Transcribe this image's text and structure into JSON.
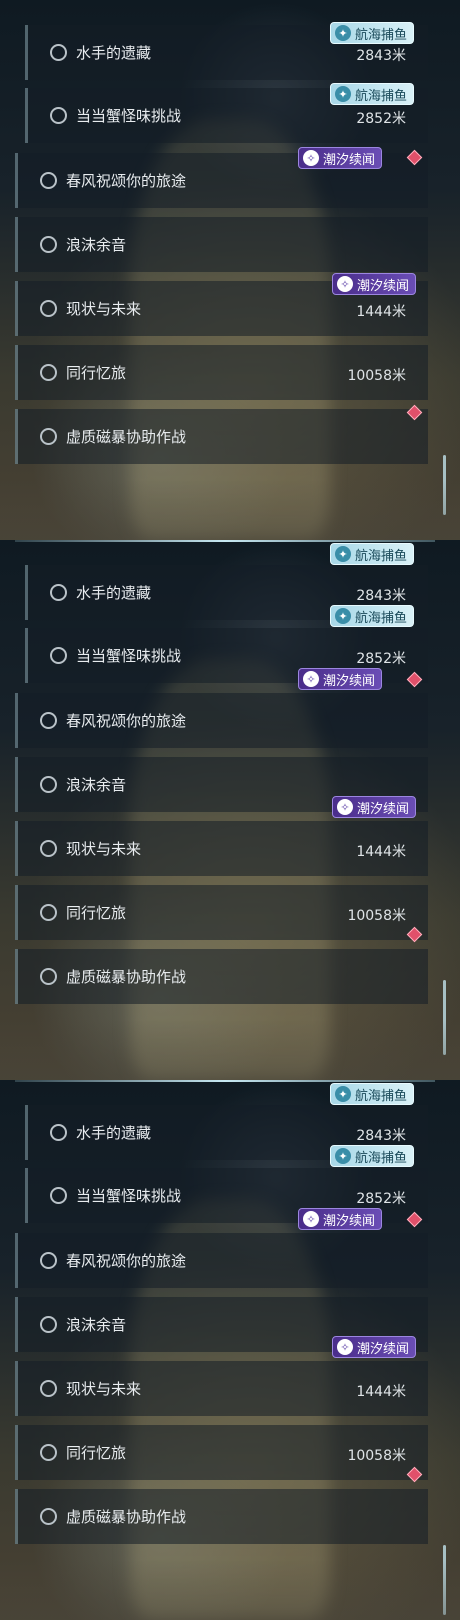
{
  "panels": [
    {
      "items": [
        {
          "label": "水手的遗藏",
          "distance": "2843米",
          "tag": "航海捕鱼"
        },
        {
          "label": "当当蟹怪味挑战",
          "distance": "2852米",
          "tag": "航海捕鱼"
        },
        {
          "label": "春风祝颂你的旅途",
          "distance": "",
          "tag": "潮汐续闻"
        },
        {
          "label": "浪沫余音",
          "distance": "",
          "tag": ""
        },
        {
          "label": "现状与未来",
          "distance": "1444米",
          "tag": "潮汐续闻"
        },
        {
          "label": "同行忆旅",
          "distance": "10058米",
          "tag": ""
        },
        {
          "label": "虚质磁暴协助作战",
          "distance": "",
          "tag": ""
        }
      ]
    },
    {
      "items": [
        {
          "label": "水手的遗藏",
          "distance": "2843米",
          "tag": "航海捕鱼"
        },
        {
          "label": "当当蟹怪味挑战",
          "distance": "2852米",
          "tag": "航海捕鱼"
        },
        {
          "label": "春风祝颂你的旅途",
          "distance": "",
          "tag": "潮汐续闻"
        },
        {
          "label": "浪沫余音",
          "distance": "",
          "tag": ""
        },
        {
          "label": "现状与未来",
          "distance": "1444米",
          "tag": "潮汐续闻"
        },
        {
          "label": "同行忆旅",
          "distance": "10058米",
          "tag": ""
        },
        {
          "label": "虚质磁暴协助作战",
          "distance": "",
          "tag": ""
        }
      ]
    },
    {
      "items": [
        {
          "label": "水手的遗藏",
          "distance": "2843米",
          "tag": "航海捕鱼"
        },
        {
          "label": "当当蟹怪味挑战",
          "distance": "2852米",
          "tag": "航海捕鱼"
        },
        {
          "label": "春风祝颂你的旅途",
          "distance": "",
          "tag": "潮汐续闻"
        },
        {
          "label": "浪沫余音",
          "distance": "",
          "tag": ""
        },
        {
          "label": "现状与未来",
          "distance": "1444米",
          "tag": "潮汐续闻"
        },
        {
          "label": "同行忆旅",
          "distance": "10058米",
          "tag": ""
        },
        {
          "label": "虚质磁暴协助作战",
          "distance": "",
          "tag": ""
        }
      ]
    }
  ],
  "colors": {
    "sea_tag": "#bfe6f0",
    "tide_tag": "#5a3da0",
    "new_marker": "#e0506a"
  },
  "icons": {
    "sea_tag": "fishing-icon",
    "tide_tag": "tide-icon",
    "status": "circle-icon",
    "marker": "red-diamond-icon"
  }
}
